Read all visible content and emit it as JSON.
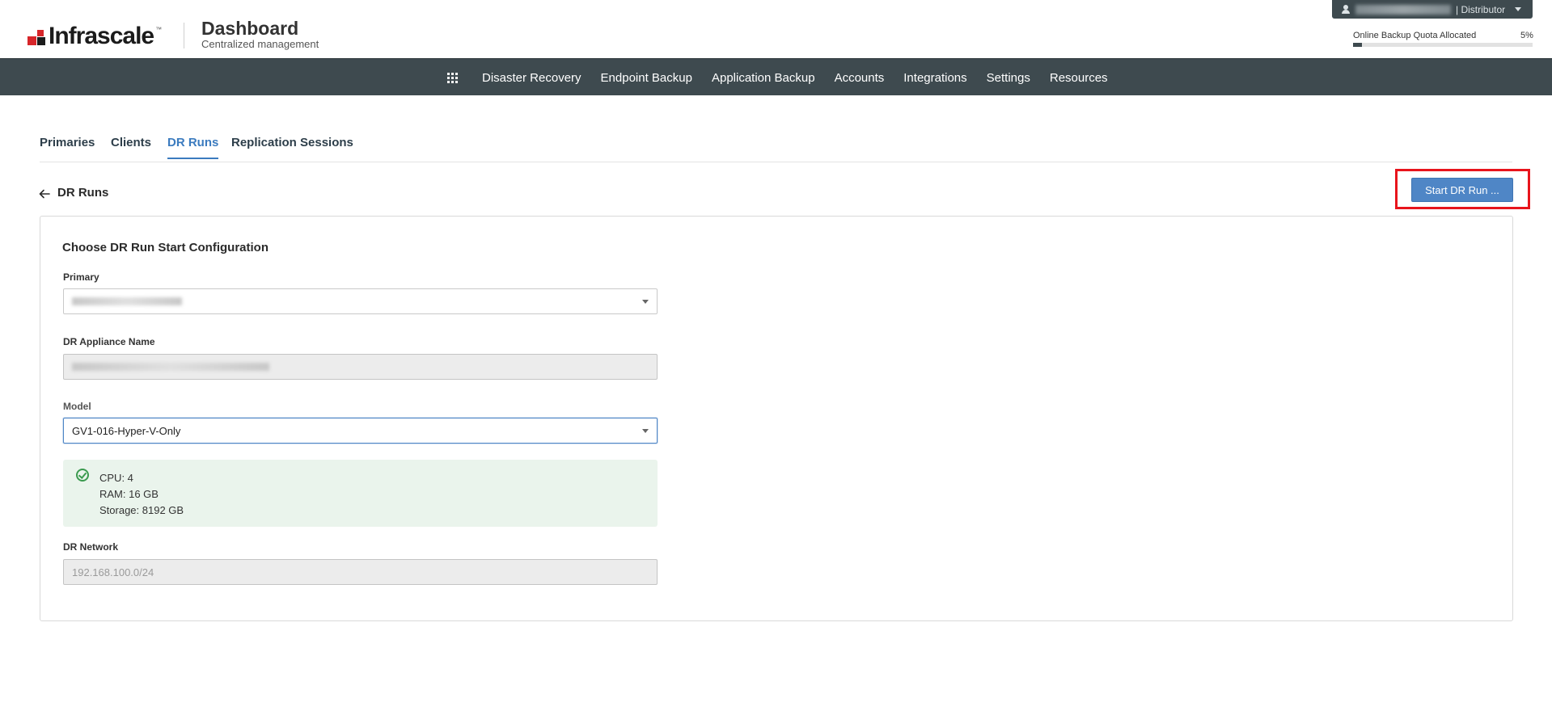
{
  "header": {
    "logo_text": "Infrascale",
    "logo_tm": "™",
    "title": "Dashboard",
    "subtitle": "Centralized management",
    "user_role": "| Distributor",
    "quota_label": "Online Backup Quota Allocated",
    "quota_percent_text": "5%",
    "quota_fraction": 0.05,
    "icons": [
      "user-icon",
      "chevron-down-icon"
    ]
  },
  "nav": {
    "grid_icon": "apps-grid-icon",
    "items": [
      "Disaster Recovery",
      "Endpoint Backup",
      "Application Backup",
      "Accounts",
      "Integrations",
      "Settings",
      "Resources"
    ]
  },
  "tabs": [
    {
      "label": "Primaries",
      "active": false
    },
    {
      "label": "Clients",
      "active": false
    },
    {
      "label": "DR Runs",
      "active": true
    },
    {
      "label": "Replication Sessions",
      "active": false
    }
  ],
  "page": {
    "heading": "DR Runs",
    "back_icon": "arrow-left-icon",
    "start_button": "Start DR Run ...",
    "highlight_color": "#e8141c",
    "accent_color": "#4f86c6"
  },
  "form": {
    "title": "Choose DR Run Start Configuration",
    "primary_label": "Primary",
    "appliance_label": "DR Appliance Name",
    "model_label": "Model",
    "model_value": "GV1-016-Hyper-V-Only",
    "specs": {
      "cpu": "CPU: 4",
      "ram": "RAM: 16 GB",
      "storage": "Storage: 8192 GB"
    },
    "network_label": "DR Network",
    "network_value": "192.168.100.0/24"
  }
}
